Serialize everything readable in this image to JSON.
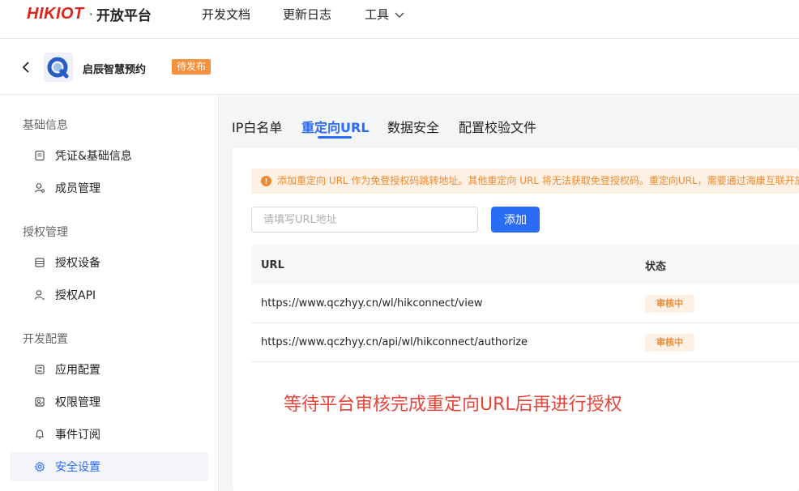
{
  "nav": {
    "brand": "HIKIOT",
    "dot": "·",
    "subtitle": "开放平台",
    "docs": "开发文档",
    "changelog": "更新日志",
    "tools": "工具"
  },
  "app": {
    "name": "启辰智慧预约",
    "status_badge": "待发布"
  },
  "sidebar": {
    "groups": [
      {
        "title": "基础信息",
        "items": [
          {
            "label": "凭证&基础信息",
            "icon": "credential-icon"
          },
          {
            "label": "成员管理",
            "icon": "members-icon"
          }
        ]
      },
      {
        "title": "授权管理",
        "items": [
          {
            "label": "授权设备",
            "icon": "device-icon"
          },
          {
            "label": "授权API",
            "icon": "api-icon"
          }
        ]
      },
      {
        "title": "开发配置",
        "items": [
          {
            "label": "应用配置",
            "icon": "app-config-icon"
          },
          {
            "label": "权限管理",
            "icon": "permission-icon"
          },
          {
            "label": "事件订阅",
            "icon": "bell-icon"
          },
          {
            "label": "安全设置",
            "icon": "gear-icon"
          }
        ]
      }
    ],
    "active": "安全设置"
  },
  "tabs": [
    {
      "label": "IP白名单"
    },
    {
      "label": "重定向URL"
    },
    {
      "label": "数据安全"
    },
    {
      "label": "配置校验文件"
    }
  ],
  "active_tab": "重定向URL",
  "notice": "添加重定向 URL 作为免登授权码跳转地址。其他重定向 URL 将无法获取免登授权码。重定向URL，需要通过海康互联开放平台审核",
  "form": {
    "placeholder": "请填写URL地址",
    "add_label": "添加"
  },
  "table": {
    "headers": [
      "URL",
      "状态"
    ],
    "rows": [
      {
        "url": "https://www.qczhyy.cn/wl/hikconnect/view",
        "status": "审核中"
      },
      {
        "url": "https://www.qczhyy.cn/api/wl/hikconnect/authorize",
        "status": "审核中"
      }
    ]
  },
  "annotation": "等待平台审核完成重定向URL后再进行授权",
  "colors": {
    "accent": "#2a6cf6",
    "brand_red": "#e0231b",
    "warning": "#f08a2c",
    "annotation_red": "#e8453a"
  }
}
